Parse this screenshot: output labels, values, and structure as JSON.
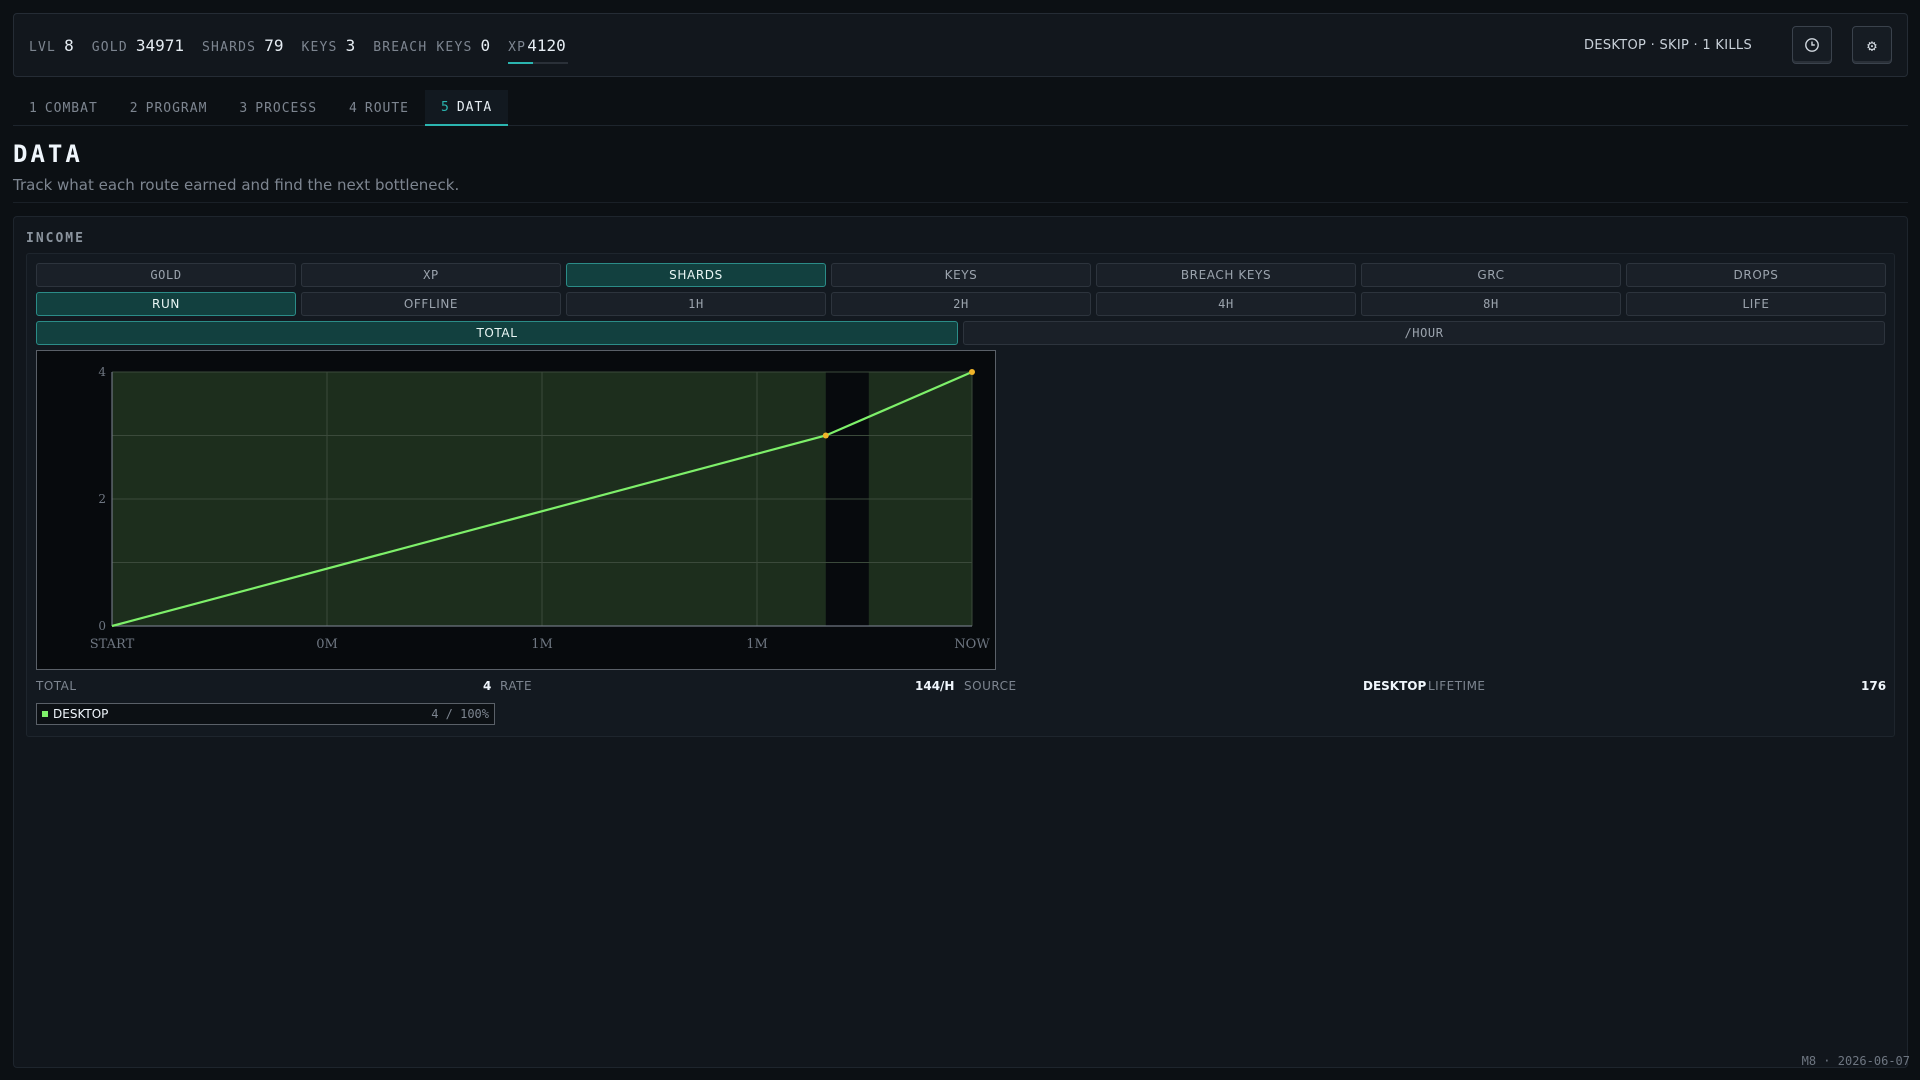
{
  "status": {
    "level": {
      "label": "LVL",
      "value": "8"
    },
    "gold": {
      "label": "GOLD",
      "value": "34971"
    },
    "shards": {
      "label": "SHARDS",
      "value": "79"
    },
    "keys": {
      "label": "KEYS",
      "value": "3"
    },
    "breach_keys": {
      "label": "BREACH KEYS",
      "value": "0"
    },
    "xp": {
      "label": "XP",
      "value": "4120",
      "progress": 0.42
    },
    "mode_text": "DESKTOP · SKIP · 1 KILLS",
    "history_icon": "clock-icon",
    "settings_icon": "gear-icon"
  },
  "tabs": [
    {
      "num": "1",
      "label": "COMBAT"
    },
    {
      "num": "2",
      "label": "PROGRAM"
    },
    {
      "num": "3",
      "label": "PROCESS"
    },
    {
      "num": "4",
      "label": "ROUTE"
    },
    {
      "num": "5",
      "label": "DATA",
      "active": true
    }
  ],
  "page": {
    "title": "DATA",
    "subtitle": "Track what each route earned and find the next bottleneck."
  },
  "income": {
    "title": "INCOME",
    "resources": [
      "GOLD",
      "XP",
      "SHARDS",
      "KEYS",
      "BREACH KEYS",
      "GRC",
      "DROPS"
    ],
    "resource_active": "SHARDS",
    "windows": [
      "RUN",
      "OFFLINE",
      "1H",
      "2H",
      "4H",
      "8H",
      "LIFE"
    ],
    "window_active": "RUN",
    "modes": [
      "TOTAL",
      "/HOUR"
    ],
    "mode_active": "TOTAL",
    "summary": {
      "total_label": "TOTAL",
      "total_value": "4",
      "rate_label": "RATE",
      "rate_value": "144/H",
      "source_label": "SOURCE",
      "source_value": "DESKTOP",
      "lifetime_label": "LIFETIME",
      "lifetime_value": "176"
    },
    "legend": [
      {
        "name": "DESKTOP",
        "value": "4 / 100%",
        "color": "#7ef06a"
      }
    ]
  },
  "chart_data": {
    "type": "line",
    "x_ticks": [
      "START",
      "0M",
      "1M",
      "1M",
      "NOW"
    ],
    "y_ticks": [
      "0",
      "2",
      "4"
    ],
    "ylim": [
      0,
      4
    ],
    "series": [
      {
        "name": "DESKTOP",
        "color": "#7ef06a",
        "x": [
          0,
          0.83,
          1
        ],
        "y": [
          0,
          3,
          4
        ]
      }
    ],
    "markers": [
      1,
      2
    ],
    "marker_color": "#f0b429",
    "offline_gap": [
      0.83,
      0.88
    ],
    "grid": true
  },
  "footer": {
    "stamp": "M8 · 2026-06-07"
  },
  "colors": {
    "accent": "#2bb5b0",
    "line": "#7ef06a",
    "plot_fill": "#1d2e1d"
  }
}
